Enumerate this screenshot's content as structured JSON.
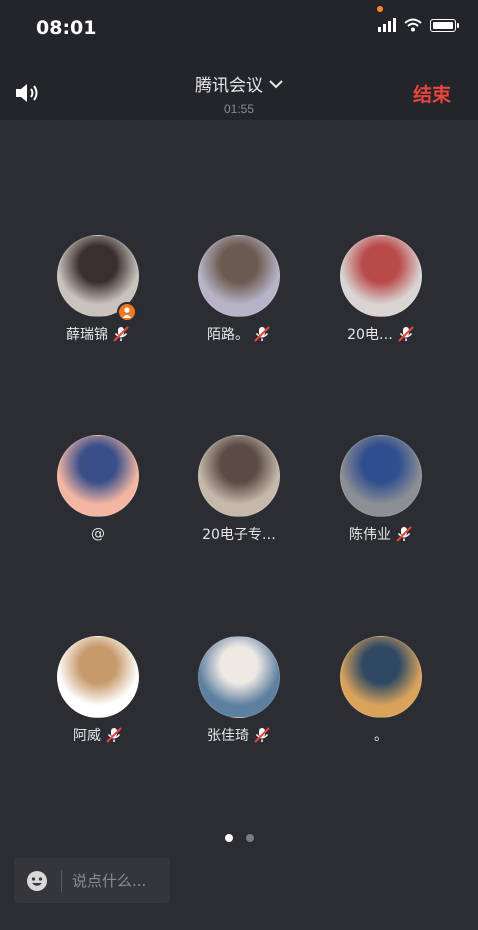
{
  "status_bar": {
    "time": "08:01"
  },
  "header": {
    "title": "腾讯会议",
    "timer": "01:55",
    "end_label": "结束"
  },
  "members": [
    {
      "name": "薛瑞锦",
      "muted": true,
      "host": true,
      "avatar_colors": [
        "#c9c2bd",
        "#3a2f2d"
      ]
    },
    {
      "name": "陌路。",
      "muted": true,
      "host": false,
      "avatar_colors": [
        "#b7b4c8",
        "#6b5a4f"
      ]
    },
    {
      "name": "20电…",
      "muted": true,
      "host": false,
      "avatar_colors": [
        "#d9d5d3",
        "#b94a4a"
      ]
    },
    {
      "name": "@",
      "muted": false,
      "host": false,
      "avatar_colors": [
        "#f3b6a2",
        "#3a4f8a"
      ]
    },
    {
      "name": "20电子专…",
      "muted": false,
      "host": false,
      "avatar_colors": [
        "#c4b9ab",
        "#5a4b45"
      ]
    },
    {
      "name": "陈伟业",
      "muted": true,
      "host": false,
      "avatar_colors": [
        "#8c8f94",
        "#2f4e8e"
      ]
    },
    {
      "name": "阿威",
      "muted": true,
      "host": false,
      "avatar_colors": [
        "#ffffff",
        "#c79a6b"
      ]
    },
    {
      "name": "张佳琦",
      "muted": true,
      "host": false,
      "avatar_colors": [
        "#5d7fa0",
        "#efe9e4"
      ]
    },
    {
      "name": "。",
      "muted": false,
      "host": false,
      "avatar_colors": [
        "#d9a35c",
        "#2f4963"
      ]
    }
  ],
  "pagination": {
    "pages": 2,
    "active": 0
  },
  "chat": {
    "placeholder": "说点什么..."
  },
  "colors": {
    "accent_end": "#e8453c",
    "host_badge": "#f07a23",
    "background": "#2b2d32"
  }
}
